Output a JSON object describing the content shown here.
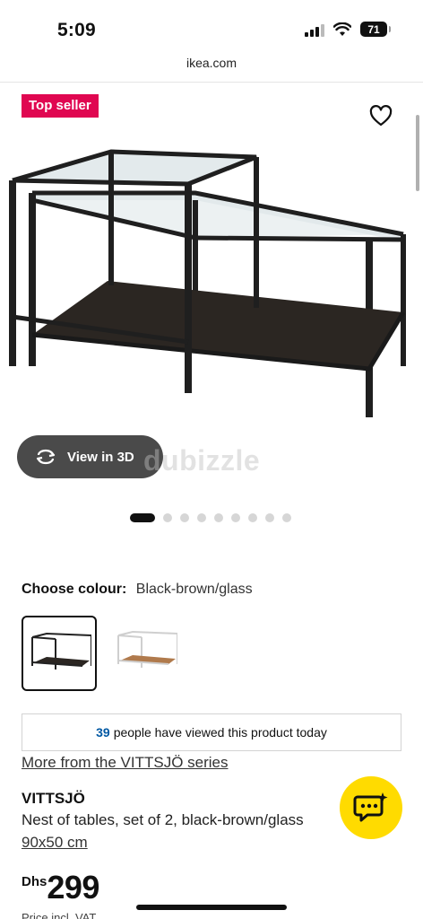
{
  "status": {
    "time": "5:09",
    "battery": "71"
  },
  "browser": {
    "url": "ikea.com"
  },
  "hero": {
    "badge": "Top seller",
    "view3d_label": "View in 3D",
    "watermark": "dubizzle",
    "carousel": {
      "total": 9,
      "active_index": 0
    }
  },
  "colour": {
    "label": "Choose colour:",
    "value": "Black-brown/glass",
    "options": [
      "Black-brown/glass",
      "White/glass"
    ],
    "selected_index": 0
  },
  "viewed": {
    "count": "39",
    "text": "people have viewed this product today"
  },
  "product": {
    "series_link": "More from the VITTSJÖ series",
    "name": "VITTSJÖ",
    "description": "Nest of tables, set of 2, black-brown/glass",
    "size": "90x50 cm",
    "currency": "Dhs",
    "price": "299",
    "price_note": "Price incl. VAT"
  },
  "colors": {
    "badge": "#e00751",
    "chat": "#ffdb00",
    "viewed_count": "#0058a3"
  },
  "icons": [
    "heart-icon",
    "rotate-3d-icon",
    "chat-sparkle-icon",
    "wifi-icon",
    "signal-icon"
  ]
}
